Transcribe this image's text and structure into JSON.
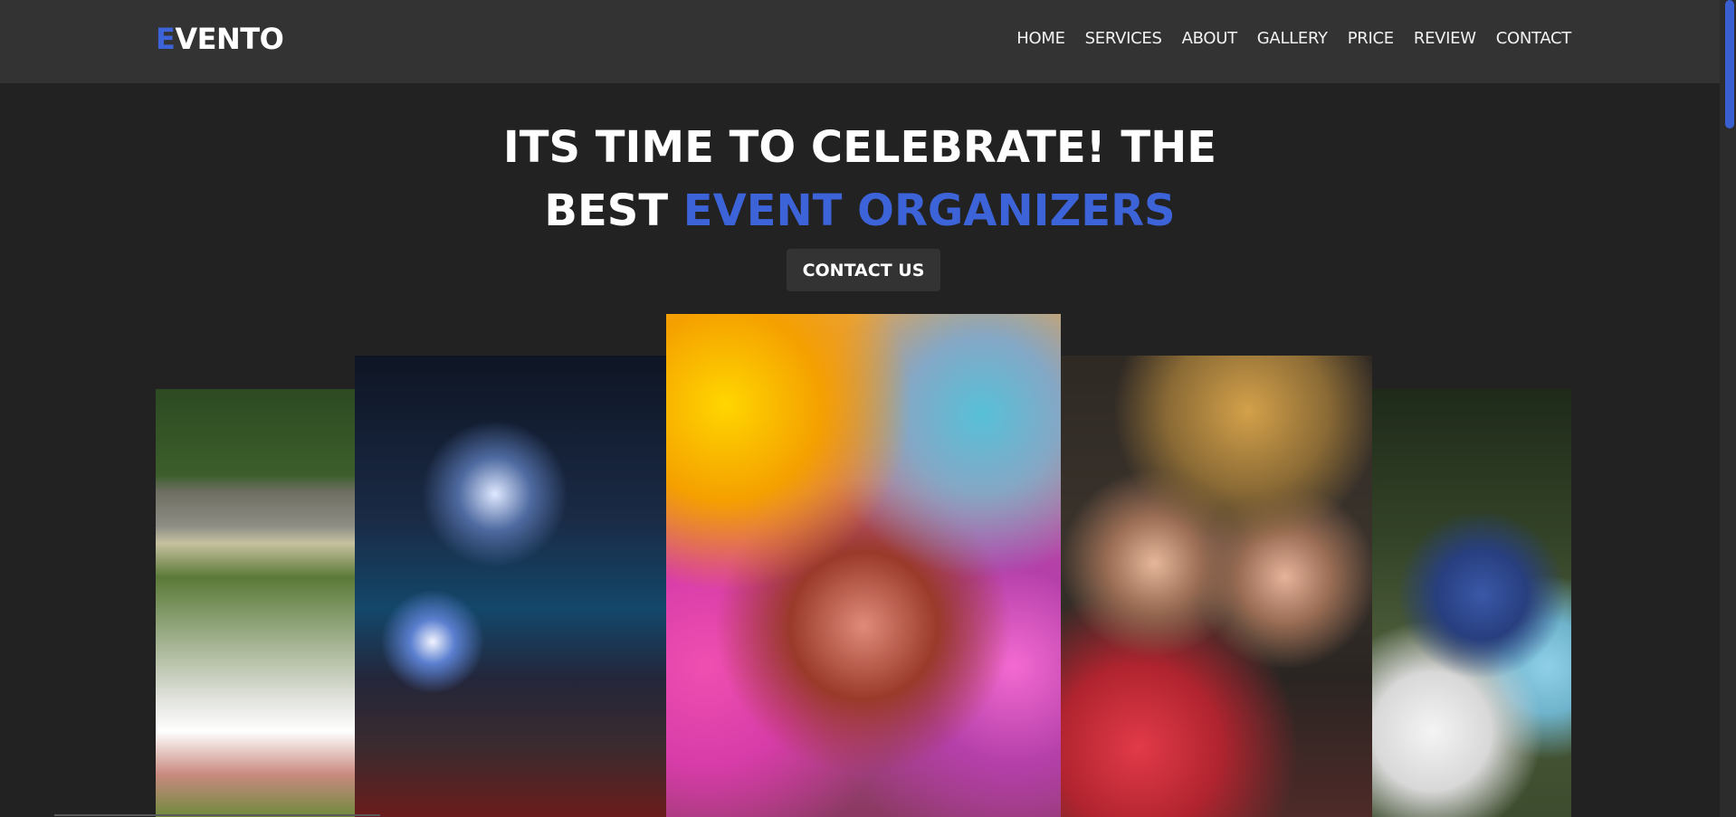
{
  "header": {
    "logo_first_letter": "E",
    "logo_rest": "VENTO",
    "nav": [
      "HOME",
      "SERVICES",
      "ABOUT",
      "GALLERY",
      "PRICE",
      "REVIEW",
      "CONTACT"
    ]
  },
  "hero": {
    "title_line1": "ITS TIME TO CELEBRATE! THE",
    "title_line2_plain": "BEST ",
    "title_line2_accent": "EVENT ORGANIZERS",
    "cta_label": "CONTACT US"
  },
  "colors": {
    "accent": "#3d63d8",
    "header_bg": "#333333",
    "page_bg": "#222222"
  }
}
